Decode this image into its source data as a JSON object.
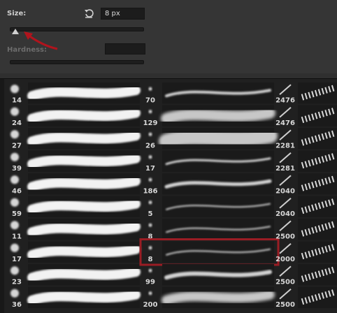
{
  "size": {
    "label": "Size:",
    "value": "8 px",
    "slider_percent": 2
  },
  "hardness": {
    "label": "Hardness:",
    "value": ""
  },
  "icons": {
    "reset": "reset-arrow-icon",
    "annotation": "red-arrow-annotation"
  },
  "colors": {
    "panel": "#353535",
    "grid_bg": "#181818",
    "selection": "#9a1d24"
  },
  "brushes": {
    "col1": [
      "14",
      "24",
      "27",
      "39",
      "46",
      "59",
      "11",
      "17",
      "23",
      "36"
    ],
    "col2": [
      "70",
      "129",
      "26",
      "17",
      "186",
      "5",
      "8",
      "8",
      "99",
      "200"
    ],
    "col3": [
      "2476",
      "2476",
      "2281",
      "2281",
      "2040",
      "2040",
      "2500",
      "2000",
      "2500",
      "2500"
    ],
    "selected": {
      "column": 2,
      "index": 7
    }
  }
}
